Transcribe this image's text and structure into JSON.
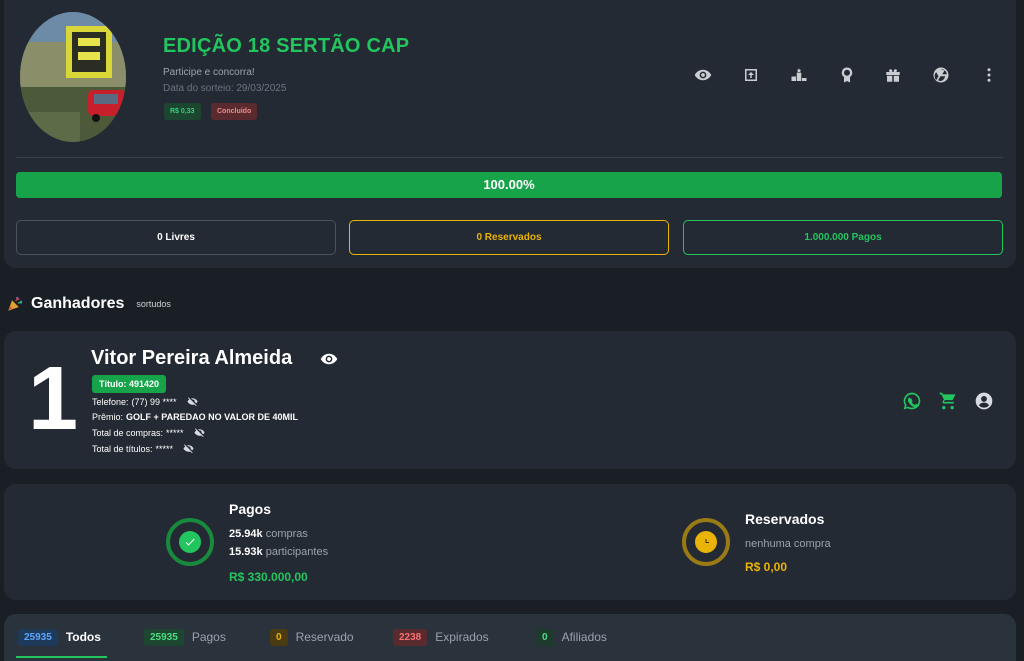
{
  "raffle": {
    "title": "EDIÇÃO 18 SERTÃO CAP",
    "subtitle": "Participe e concorra!",
    "draw_date": "Data do sorteio: 29/03/2025",
    "price_badge": "R$ 0,33",
    "status_badge": "Concluído",
    "progress_value": 1.0,
    "progress_label": "100.00%",
    "stats": {
      "free": "0 Livres",
      "reserved": "0 Reservados",
      "paid": "1.000.000 Pagos"
    },
    "toolbar_icons": [
      "eye-icon",
      "share-icon",
      "podium-icon",
      "award-icon",
      "gift-icon",
      "wheel-icon",
      "more-vert-icon"
    ]
  },
  "winners": {
    "title": "Ganhadores",
    "subtitle": "sortudos",
    "items": [
      {
        "rank": "1",
        "name": "Vitor Pereira Almeida",
        "ticket": "Título: 491420",
        "phone_label": "Telefone:",
        "phone_value": "(77) 99 ****",
        "prize_label": "Prêmio:",
        "prize_value": "GOLF + PAREDAO NO VALOR DE 40MIL",
        "purchases_label": "Total de compras:",
        "purchases_value": "*****",
        "titles_label": "Total de títulos:",
        "titles_value": "*****"
      }
    ]
  },
  "summary": {
    "paid": {
      "title": "Pagos",
      "purchases_value": "25.94k",
      "purchases_label": "compras",
      "participants_value": "15.93k",
      "participants_label": "participantes",
      "amount": "R$ 330.000,00"
    },
    "reserved": {
      "title": "Reservados",
      "note": "nenhuma compra",
      "amount": "R$ 0,00"
    }
  },
  "tabs": [
    {
      "count": "25935",
      "label": "Todos",
      "active": true
    },
    {
      "count": "25935",
      "label": "Pagos"
    },
    {
      "count": "0",
      "label": "Reservado"
    },
    {
      "count": "2238",
      "label": "Expirados"
    },
    {
      "count": "0",
      "label": "Afiliados"
    }
  ],
  "colors": {
    "accent_green": "#22c55e",
    "accent_yellow": "#eab308",
    "card_bg": "#232a33",
    "page_bg": "#1a1f26"
  }
}
